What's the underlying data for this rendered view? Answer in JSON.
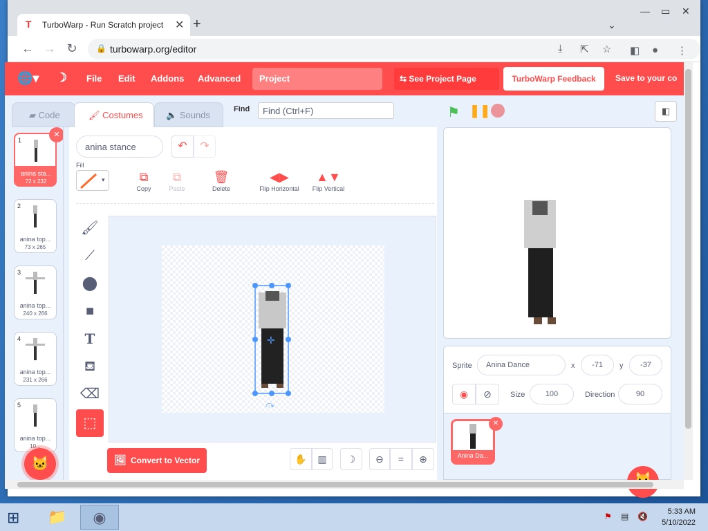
{
  "browser": {
    "tab_title": "TurboWarp - Run Scratch project",
    "url": "turbowarp.org/editor",
    "new_tab": "+",
    "tab_close": "✕"
  },
  "menubar": {
    "file": "File",
    "edit": "Edit",
    "addons": "Addons",
    "advanced": "Advanced",
    "project_title": "Project",
    "see_project_page": "See Project Page",
    "feedback": "TurboWarp Feedback",
    "save": "Save to your co"
  },
  "editor_tabs": {
    "code": "Code",
    "costumes": "Costumes",
    "sounds": "Sounds"
  },
  "find": {
    "label": "Find",
    "placeholder": "Find (Ctrl+F)"
  },
  "costumes": [
    {
      "num": "1",
      "name": "anina sta...",
      "size": "72 x 232"
    },
    {
      "num": "2",
      "name": "anina top...",
      "size": "73 x 265"
    },
    {
      "num": "3",
      "name": "anina top...",
      "size": "240 x 266"
    },
    {
      "num": "4",
      "name": "anina top...",
      "size": "231 x 266"
    },
    {
      "num": "5",
      "name": "anina top...",
      "size": "10..."
    }
  ],
  "paint": {
    "costume_name": "anina stance",
    "fill_label": "Fill",
    "copy": "Copy",
    "paste": "Paste",
    "delete": "Delete",
    "flip_h": "Flip Horizontal",
    "flip_v": "Flip Vertical",
    "convert": "Convert to Vector"
  },
  "sprite": {
    "label": "Sprite",
    "name": "Anina Dance",
    "x_label": "x",
    "x": "-71",
    "y_label": "y",
    "y": "-37",
    "size_label": "Size",
    "size": "100",
    "direction_label": "Direction",
    "direction": "90",
    "card_name": "Anina Da..."
  },
  "taskbar": {
    "time": "5:33 AM",
    "date": "5/10/2022"
  },
  "colors": {
    "accent": "#ff4c4c",
    "selection": "#4c97ff",
    "green_flag": "#4cbf56",
    "pause": "#ffab19"
  }
}
